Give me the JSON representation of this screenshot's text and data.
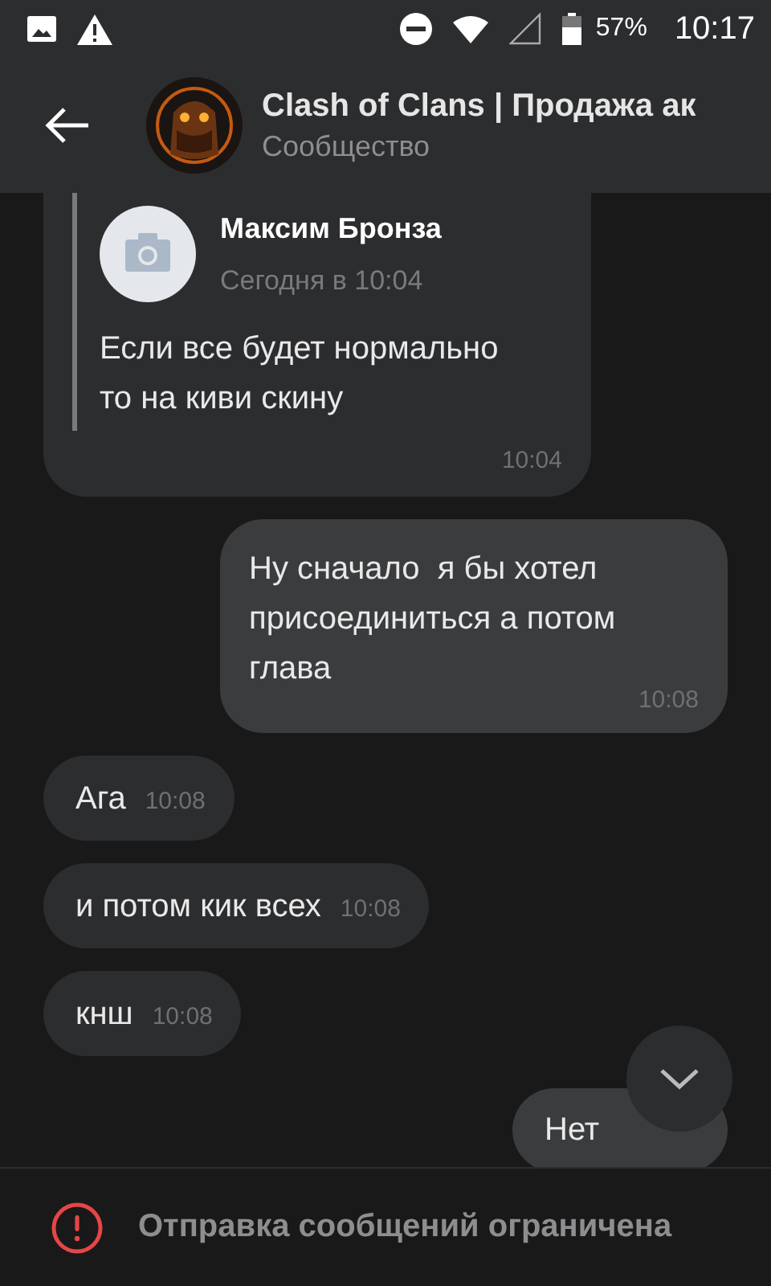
{
  "status_bar": {
    "battery": "57%",
    "time": "10:17"
  },
  "header": {
    "title": "Clash of Clans | Продажа ак",
    "subtitle": "Сообщество"
  },
  "messages": [
    {
      "kind": "incoming",
      "reply": {
        "author": "Максим Бронза",
        "date": "Сегодня в 10:04",
        "text": "Если все будет нормально то на киви скину"
      },
      "time": "10:04"
    },
    {
      "kind": "outgoing",
      "text": "Ну сначало  я бы хотел присоединиться а потом глава",
      "time": "10:08"
    },
    {
      "kind": "incoming",
      "text": "Ага",
      "time": "10:08"
    },
    {
      "kind": "incoming",
      "text": "и потом кик всех",
      "time": "10:08"
    },
    {
      "kind": "incoming",
      "text": "кнш",
      "time": "10:08"
    },
    {
      "kind": "outgoing",
      "text": "Нет"
    }
  ],
  "footer": {
    "notice": "Отправка сообщений ограничена"
  }
}
